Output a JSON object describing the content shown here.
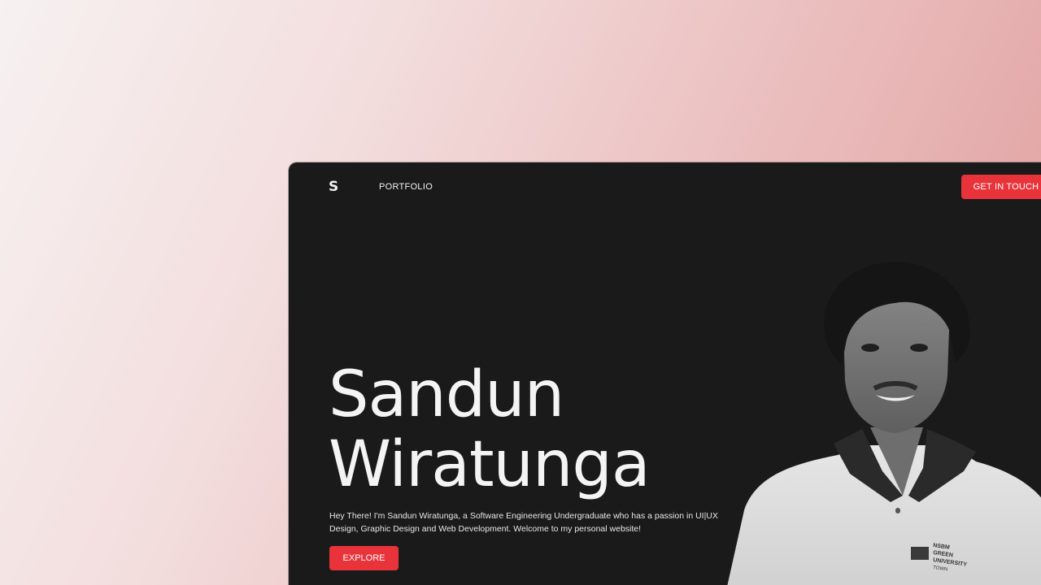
{
  "nav": {
    "logo_text": "S",
    "portfolio_label": "PORTFOLIO",
    "cta_label": "GET IN TOUCH"
  },
  "hero": {
    "first_name": "Sandun",
    "last_name": "Wiratunga",
    "intro": "Hey There! I'm Sandun Wiratunga, a Software Engineering Undergraduate who has a passion in UI|UX Design, Graphic Design and Web Development. Welcome to my personal website!",
    "explore_label": "EXPLORE",
    "shirt_logo_text": "NSBM GREEN UNIVERSITY TOWN"
  },
  "colors": {
    "accent": "#e9333a",
    "window_bg": "#1a1a1a",
    "text": "#f4f4f4"
  }
}
